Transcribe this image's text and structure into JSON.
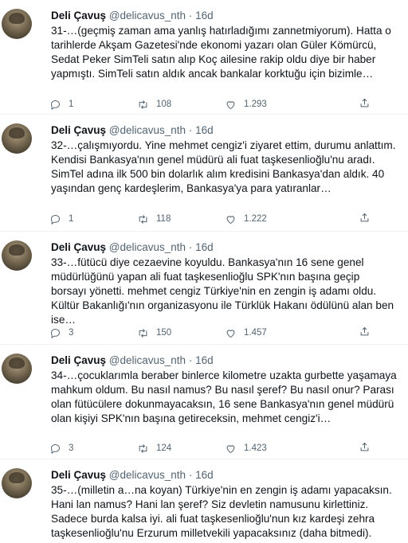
{
  "tweets": [
    {
      "name": "Deli Çavuş",
      "handle": "@delicavus_nth",
      "dot": "·",
      "time": "16d",
      "text": "31-…(geçmiş zaman ama yanlış hatırladığımı zannetmiyorum). Hatta o tarihlerde Akşam Gazetesi'nde ekonomi yazarı olan Güler Kömürcü, Sedat Peker SimTeli satın alıp Koç ailesine rakip oldu diye bir haber yapmıştı. SimTeli satın aldık ancak bankalar korktuğu için bizimle…",
      "replies": "1",
      "retweets": "108",
      "likes": "1.293"
    },
    {
      "name": "Deli Çavuş",
      "handle": "@delicavus_nth",
      "dot": "·",
      "time": "16d",
      "text": "32-…çalışmıyordu. Yine mehmet cengiz'i ziyaret ettim, durumu anlattım. Kendisi Bankasya'nın genel müdürü ali fuat taşkesenlioğlu'nu aradı. SimTel adına ilk 500 bin dolarlık alım kredisini Bankasya'dan aldık. 40 yaşından genç kardeşlerim, Bankasya'ya para yatıranlar…",
      "replies": "1",
      "retweets": "118",
      "likes": "1.222"
    },
    {
      "name": "Deli Çavuş",
      "handle": "@delicavus_nth",
      "dot": "·",
      "time": "16d",
      "text": "33-…fütücü diye cezaevine koyuldu. Bankasya'nın 16 sene genel müdürlüğünü yapan ali fuat taşkesenlioğlu SPK'nın başına geçip borsayı yönetti. mehmet cengiz Türkiye'nin en zengin iş adamı oldu. Kültür Bakanlığı'nın organizasyonu ile Türklük Hakanı ödülünü alan ben ise…",
      "replies": "3",
      "retweets": "150",
      "likes": "1.457"
    },
    {
      "name": "Deli Çavuş",
      "handle": "@delicavus_nth",
      "dot": "·",
      "time": "16d",
      "text": "34-…çocuklarımla beraber binlerce kilometre uzakta gurbette yaşamaya mahkum oldum. Bu nasıl namus? Bu nasıl şeref? Bu nasıl onur? Parası olan fütücülere dokunmayacaksın, 16 sene Bankasya'nın genel müdürü olan kişiyi SPK'nın başına getireceksin, mehmet cengiz'i…",
      "replies": "3",
      "retweets": "124",
      "likes": "1.423"
    },
    {
      "name": "Deli Çavuş",
      "handle": "@delicavus_nth",
      "dot": "·",
      "time": "16d",
      "text": "35-…(milletin a…na koyan) Türkiye'nin en zengin iş adamı yapacaksın. Hani lan namus? Hani lan şeref? Siz devletin namusunu kirlettiniz. Sadece burda kalsa iyi. ali fuat taşkesenlioğlu'nun kız kardeşi zehra taşkesenlioğlu'nu Erzurum milletvekili yapacaksınız (daha bitmedi).",
      "replies": "",
      "retweets": "",
      "likes": ""
    }
  ]
}
